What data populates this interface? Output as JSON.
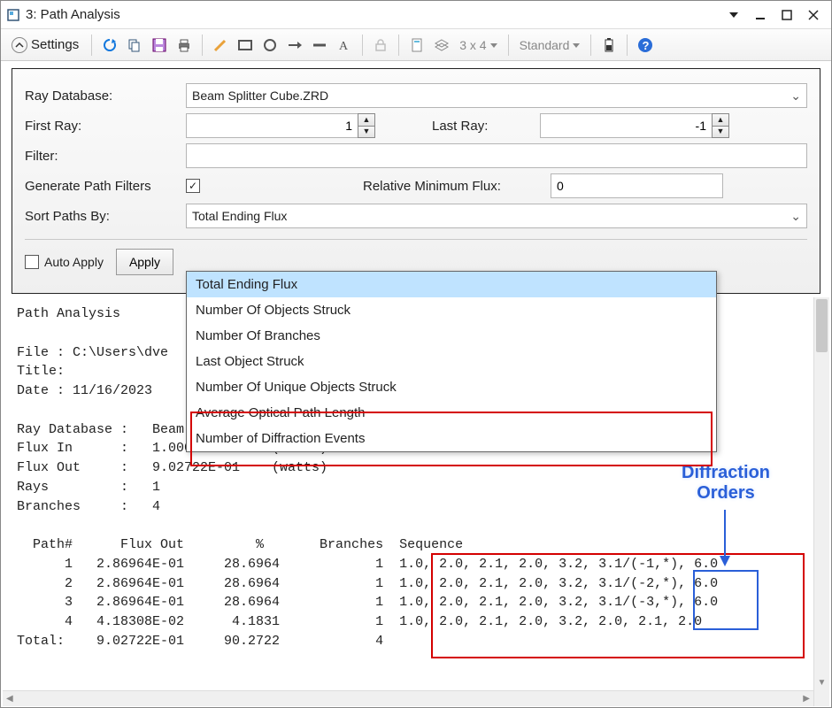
{
  "window": {
    "title": "3: Path Analysis"
  },
  "toolbar": {
    "settings_label": "Settings",
    "grid_label": "3 x 4",
    "style_label": "Standard"
  },
  "form": {
    "ray_db_label": "Ray Database:",
    "ray_db_value": "Beam Splitter Cube.ZRD",
    "first_ray_label": "First Ray:",
    "first_ray_value": "1",
    "last_ray_label": "Last Ray:",
    "last_ray_value": "-1",
    "filter_label": "Filter:",
    "filter_value": "",
    "gen_filters_label": "Generate Path Filters",
    "gen_filters_checked": "✓",
    "rel_flux_label": "Relative Minimum Flux:",
    "rel_flux_value": "0",
    "sort_label": "Sort Paths By:",
    "sort_value": "Total Ending Flux",
    "auto_apply_label": "Auto Apply",
    "apply_label": "Apply"
  },
  "dropdown": {
    "options": [
      "Total Ending Flux",
      "Number Of Objects Struck",
      "Number Of Branches",
      "Last Object Struck",
      "Number Of Unique Objects Struck",
      "Average Optical Path Length",
      "Number of Diffraction Events"
    ]
  },
  "output": {
    "heading": "Path Analysis",
    "file_line": "File : C:\\Users\\dve                                                        eamSplitter",
    "title_line": "Title:",
    "date_line": "Date : 11/16/2023",
    "db_line": "Ray Database :   Beam Splitter Cube.ZRD",
    "fluxin": "Flux In      :   1.00000E+00    (watts)",
    "fluxout": "Flux Out     :   9.02722E-01    (watts)",
    "rays": "Rays         :   1",
    "branches": "Branches     :   4",
    "tbl_hdr": "  Path#      Flux Out         %       Branches  Sequence",
    "tbl_r1": "      1   2.86964E-01     28.6964            1  1.0, 2.0, 2.1, 2.0, 3.2, 3.1/(-1,*), 6.0",
    "tbl_r2": "      2   2.86964E-01     28.6964            1  1.0, 2.0, 2.1, 2.0, 3.2, 3.1/(-2,*), 6.0",
    "tbl_r3": "      3   2.86964E-01     28.6964            1  1.0, 2.0, 2.1, 2.0, 3.2, 3.1/(-3,*), 6.0",
    "tbl_r4": "      4   4.18308E-02      4.1831            1  1.0, 2.0, 2.1, 2.0, 3.2, 2.0, 2.1, 2.0",
    "tbl_tot": "Total:    9.02722E-01     90.2722            4"
  },
  "annotations": {
    "diffraction_label_l1": "Diffraction",
    "diffraction_label_l2": "Orders"
  }
}
